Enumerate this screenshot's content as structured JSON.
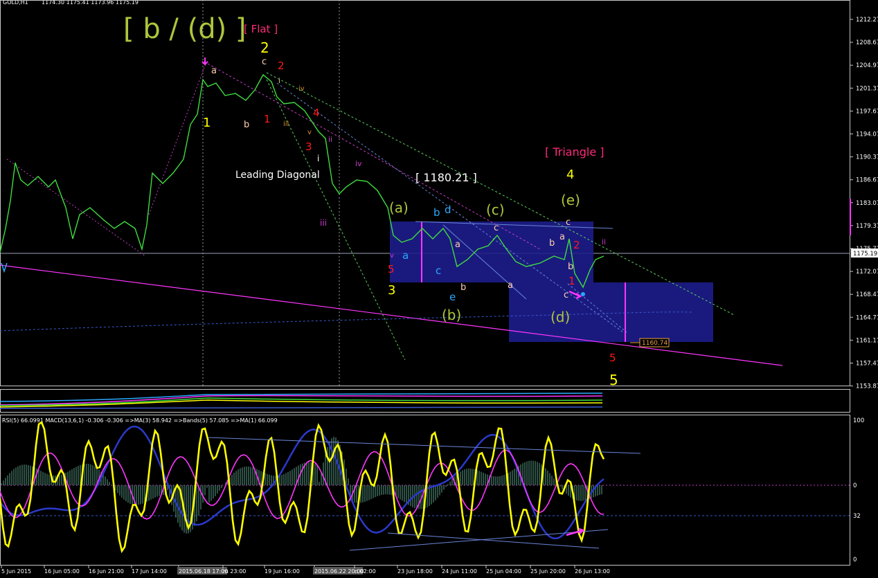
{
  "header": {
    "symbol": "GOLD,H1",
    "ohlc": "1174.30 1175.41 1173.96 1175.19"
  },
  "colors": {
    "background": "#000000",
    "candle": "#3fdc3f",
    "box": "#1d1d8c",
    "magenta": "#ff36ff",
    "yellow": "#ffff00",
    "olive": "#aec63c",
    "red": "#ff1a1a",
    "cyan": "#2aa8ff",
    "salmon": "#ffd0b0",
    "grid": "#808080"
  },
  "price_axis": {
    "ticks": [
      "1212.27",
      "1208.67",
      "1204.97",
      "1201.37",
      "1197.67",
      "1194.07",
      "1190.37",
      "1186.67",
      "1183.07",
      "1179.37",
      "1175.77",
      "1172.07",
      "1168.47",
      "1164.77",
      "1161.17",
      "1157.47",
      "1153.87"
    ],
    "current": "1175.19"
  },
  "osc_axis": {
    "ticks": [
      "100",
      "0",
      "32",
      "0"
    ]
  },
  "time_axis": {
    "labels": [
      "5 Jun 2015",
      "16 Jun 05:00",
      "16 Jun 21:00",
      "17 Jun 14:00",
      "2015.06.18 17:00",
      "m 23:00",
      "19 Jun 16:00",
      "2015.06.22 20:00",
      "n 02:00",
      "23 Jun 18:00",
      "24 Jun 11:00",
      "25 Jun 04:00",
      "25 Jun 20:00",
      "26 Jun 13:00"
    ]
  },
  "indicator_label": "RSI(5) 66.0991  MACD(13,6,1) -0.306 -0.306  =>MA(3) 58.942  =>Bands(5) 57.085  =>MA(1) 66.099",
  "annotations": {
    "main_title": "[ b / (d) ]",
    "flat": "[ Flat ]",
    "triangle": "[ Triangle ]",
    "leading_diagonal": "Leading Diagonal",
    "price_label": "[ 1180.21 ]",
    "target_label": "1160.74",
    "wave_labels": [
      {
        "t": "2",
        "c": "yellow"
      },
      {
        "t": "1",
        "c": "yellow"
      },
      {
        "t": "3",
        "c": "yellow"
      },
      {
        "t": "4",
        "c": "yellow"
      },
      {
        "t": "5",
        "c": "yellow"
      },
      {
        "t": "(a)",
        "c": "olive"
      },
      {
        "t": "(b)",
        "c": "olive"
      },
      {
        "t": "(c)",
        "c": "olive"
      },
      {
        "t": "(d)",
        "c": "olive"
      },
      {
        "t": "(e)",
        "c": "olive"
      },
      {
        "t": "a",
        "c": "salmon"
      },
      {
        "t": "b",
        "c": "salmon"
      },
      {
        "t": "c",
        "c": "salmon"
      },
      {
        "t": "2",
        "c": "red"
      },
      {
        "t": "1",
        "c": "red"
      },
      {
        "t": "4",
        "c": "red"
      },
      {
        "t": "3",
        "c": "red"
      },
      {
        "t": "5",
        "c": "red"
      },
      {
        "t": "a",
        "c": "salmon"
      },
      {
        "t": "b",
        "c": "salmon"
      },
      {
        "t": "c",
        "c": "salmon"
      },
      {
        "t": "a",
        "c": "cyan"
      },
      {
        "t": "b",
        "c": "cyan"
      },
      {
        "t": "c",
        "c": "cyan"
      },
      {
        "t": "d",
        "c": "cyan"
      },
      {
        "t": "e",
        "c": "cyan"
      },
      {
        "t": "a",
        "c": "salmon"
      },
      {
        "t": "b",
        "c": "salmon"
      },
      {
        "t": "c",
        "c": "salmon"
      },
      {
        "t": "a",
        "c": "salmon"
      },
      {
        "t": "b",
        "c": "salmon"
      },
      {
        "t": "c",
        "c": "salmon"
      },
      {
        "t": "2",
        "c": "red"
      },
      {
        "t": "1",
        "c": "red"
      },
      {
        "t": "5",
        "c": "red"
      },
      {
        "t": "iii",
        "c": "magenta"
      },
      {
        "t": "iv",
        "c": "magenta"
      },
      {
        "t": "i",
        "c": "white"
      },
      {
        "t": "ii",
        "c": "magenta"
      },
      {
        "t": "ii",
        "c": "magenta"
      },
      {
        "t": "i",
        "c": "salmon"
      },
      {
        "t": "iii",
        "c": "orange"
      },
      {
        "t": "iv",
        "c": "orange"
      },
      {
        "t": "v",
        "c": "orange"
      },
      {
        "t": "v",
        "c": "magenta"
      }
    ]
  }
}
